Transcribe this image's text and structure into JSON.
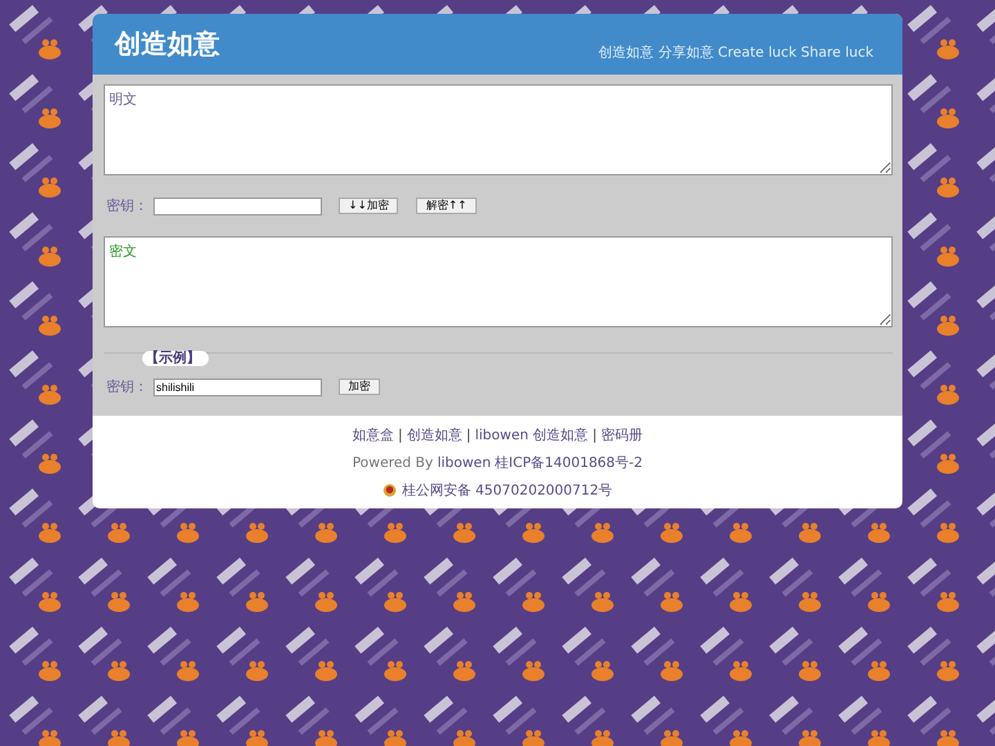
{
  "header": {
    "title": "创造如意",
    "tagline": "创造如意 分享如意 Create luck Share luck"
  },
  "plain_field": {
    "placeholder": "明文"
  },
  "key_row": {
    "label": "密钥：",
    "buttons": [
      "↓↓加密",
      "解密↑↑"
    ]
  },
  "cipher_field": {
    "placeholder": "密文"
  },
  "example": {
    "legend": "【示例】",
    "label": "密钥：",
    "value": "shilishili",
    "button": "加密"
  },
  "footer": {
    "nav": [
      {
        "text": "如意盒",
        "kind": "link"
      },
      {
        "text": "|",
        "kind": "separator"
      },
      {
        "text": "创造如意",
        "kind": "link"
      },
      {
        "text": "|",
        "kind": "separator"
      },
      {
        "text": "libowen 创造如意",
        "kind": "link"
      },
      {
        "text": "|",
        "kind": "separator"
      },
      {
        "text": "密码册",
        "kind": "link"
      }
    ],
    "powered": [
      {
        "text": "Powered By",
        "kind": "text"
      },
      {
        "text": "libowen",
        "kind": "link"
      },
      {
        "text": "桂ICP备14001868号-2",
        "kind": "link"
      }
    ],
    "police": "桂公网安备 45070202000712号"
  }
}
